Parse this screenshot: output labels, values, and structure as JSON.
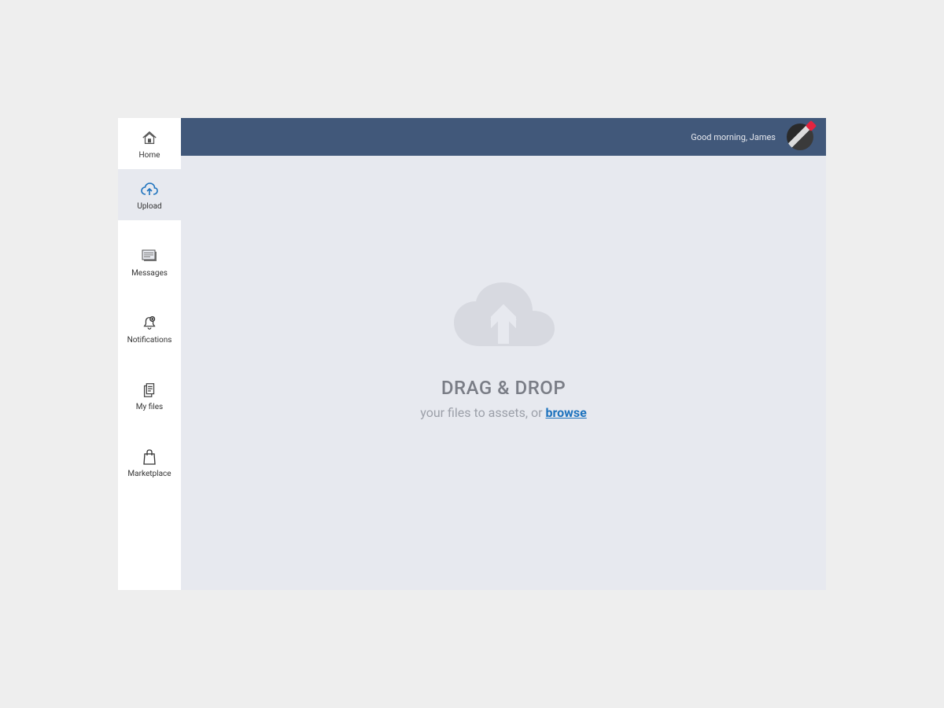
{
  "sidebar": {
    "items": [
      {
        "label": "Home",
        "icon": "home"
      },
      {
        "label": "Upload",
        "icon": "cloud-upload"
      },
      {
        "label": "Messages",
        "icon": "messages"
      },
      {
        "label": "Notifications",
        "icon": "bell"
      },
      {
        "label": "My files",
        "icon": "files"
      },
      {
        "label": "Marketplace",
        "icon": "bag"
      }
    ],
    "activeIndex": 1
  },
  "header": {
    "greeting": "Good morning, James"
  },
  "upload": {
    "title": "DRAG & DROP",
    "subtitle_prefix": "your files to assets, or ",
    "browse_label": "browse"
  },
  "colors": {
    "header_bg": "#41587A",
    "accent": "#1E73BE",
    "panel_bg": "#E7E9EF"
  }
}
